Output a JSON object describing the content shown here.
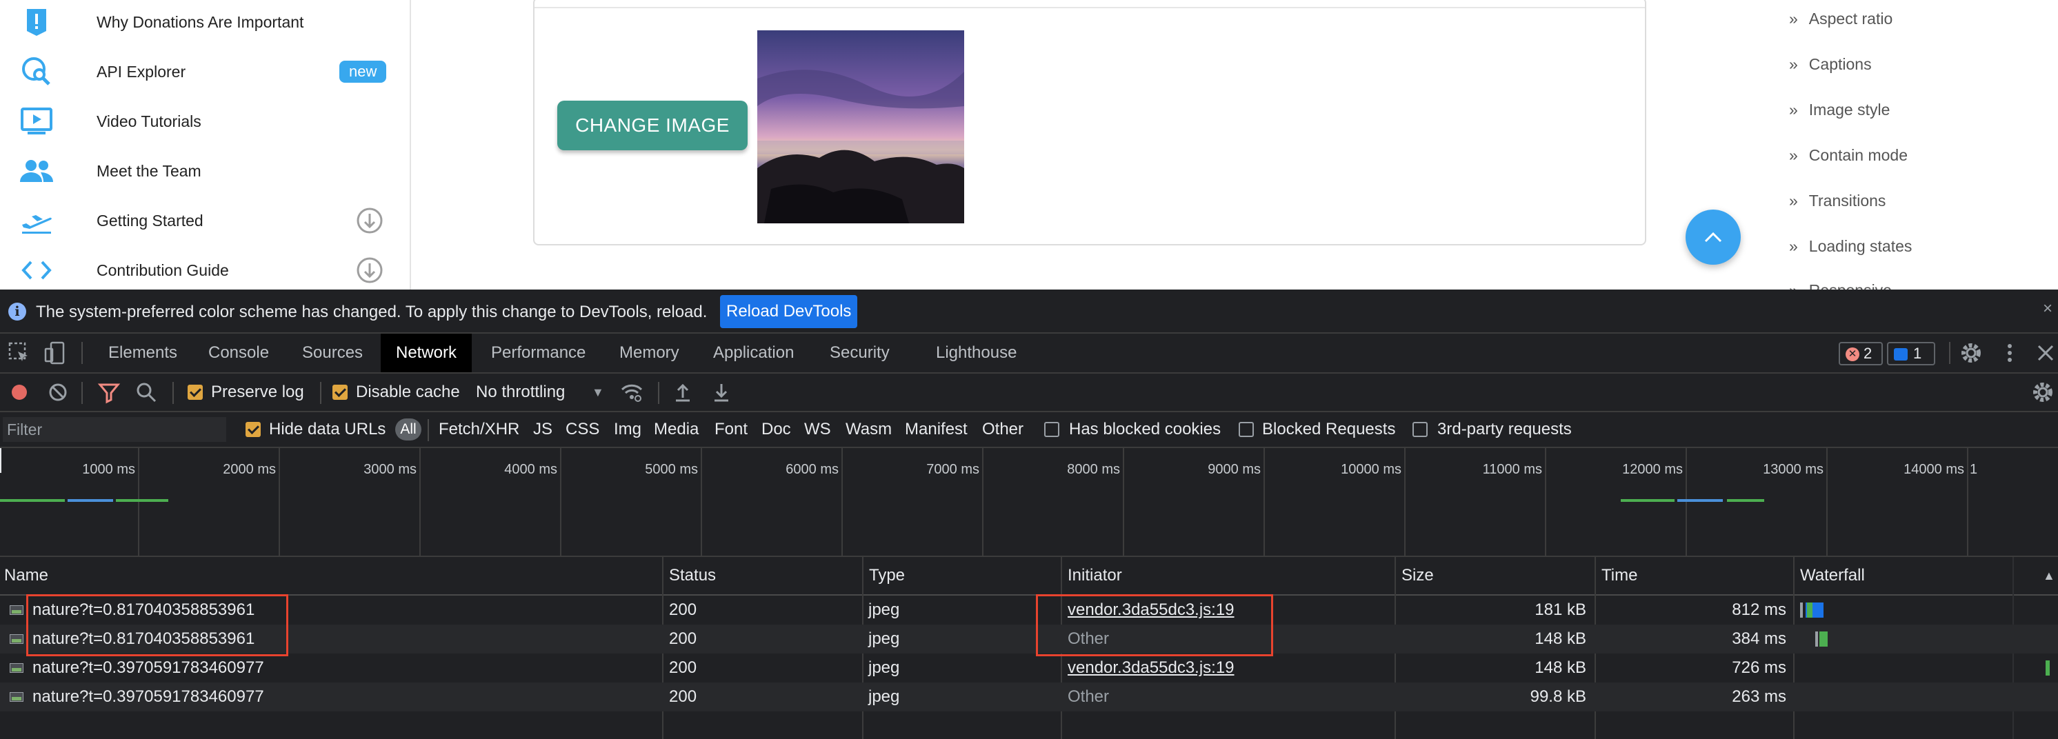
{
  "sidebar": {
    "items": [
      {
        "icon": "exclamation-icon",
        "label": "Why Donations Are Important"
      },
      {
        "icon": "api-search-icon",
        "label": "API Explorer",
        "badge": "new"
      },
      {
        "icon": "video-play-icon",
        "label": "Video Tutorials"
      },
      {
        "icon": "team-icon",
        "label": "Meet the Team"
      },
      {
        "icon": "airplane-takeoff-icon",
        "label": "Getting Started"
      },
      {
        "icon": "code-brackets-icon",
        "label": "Contribution Guide"
      }
    ]
  },
  "card": {
    "change_button_label": "CHANGE IMAGE"
  },
  "toc": {
    "items": [
      "Aspect ratio",
      "Captions",
      "Image style",
      "Contain mode",
      "Transitions",
      "Loading states",
      "Responsive"
    ]
  },
  "devtools": {
    "infobar": {
      "message": "The system-preferred color scheme has changed. To apply this change to DevTools, reload.",
      "reload_label": "Reload DevTools",
      "close_label": "×"
    },
    "tabs": [
      "Elements",
      "Console",
      "Sources",
      "Network",
      "Performance",
      "Memory",
      "Application",
      "Security",
      "Lighthouse"
    ],
    "active_tab": "Network",
    "errors_count": "2",
    "messages_count": "1",
    "toolbar": {
      "preserve_log": "Preserve log",
      "disable_cache": "Disable cache",
      "throttling": "No throttling"
    },
    "filter": {
      "placeholder": "Filter",
      "hide_data_urls": "Hide data URLs",
      "all": "All",
      "types": [
        "Fetch/XHR",
        "JS",
        "CSS",
        "Img",
        "Media",
        "Font",
        "Doc",
        "WS",
        "Wasm",
        "Manifest",
        "Other"
      ],
      "has_blocked_cookies": "Has blocked cookies",
      "blocked_requests": "Blocked Requests",
      "third_party": "3rd-party requests"
    },
    "overview_ticks": [
      "1000 ms",
      "2000 ms",
      "3000 ms",
      "4000 ms",
      "5000 ms",
      "6000 ms",
      "7000 ms",
      "8000 ms",
      "9000 ms",
      "10000 ms",
      "11000 ms",
      "12000 ms",
      "13000 ms",
      "14000 ms",
      "1"
    ],
    "columns": [
      "Name",
      "Status",
      "Type",
      "Initiator",
      "Size",
      "Time",
      "Waterfall"
    ],
    "rows": [
      {
        "name": "nature?t=0.817040358853961",
        "status": "200",
        "type": "jpeg",
        "initiator": "vendor.3da55dc3.js:19",
        "initiator_link": true,
        "size": "181 kB",
        "time": "812 ms"
      },
      {
        "name": "nature?t=0.817040358853961",
        "status": "200",
        "type": "jpeg",
        "initiator": "Other",
        "initiator_link": false,
        "size": "148 kB",
        "time": "384 ms"
      },
      {
        "name": "nature?t=0.3970591783460977",
        "status": "200",
        "type": "jpeg",
        "initiator": "vendor.3da55dc3.js:19",
        "initiator_link": true,
        "size": "148 kB",
        "time": "726 ms"
      },
      {
        "name": "nature?t=0.3970591783460977",
        "status": "200",
        "type": "jpeg",
        "initiator": "Other",
        "initiator_link": false,
        "size": "99.8 kB",
        "time": "263 ms"
      }
    ]
  },
  "colors": {
    "accent_teal": "#3f9a8b",
    "sidebar_icon": "#38a8ee",
    "highlight": "#e8432e",
    "devtools_bg": "#202124"
  }
}
